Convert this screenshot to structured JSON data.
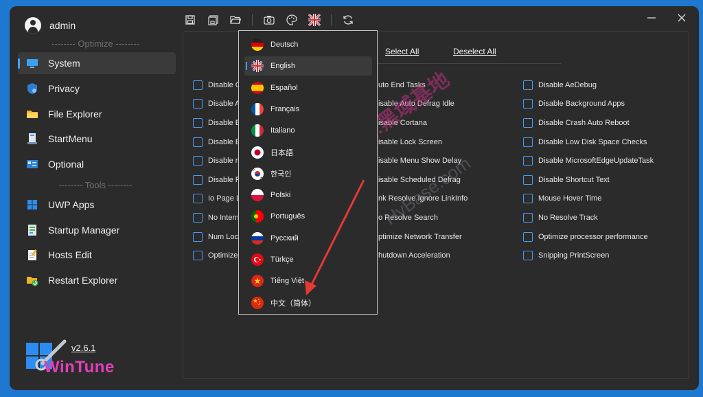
{
  "user": {
    "name": "admin"
  },
  "sidebar": {
    "optimize_title": "-------- Optimize --------",
    "tools_title": "-------- Tools --------",
    "items": [
      {
        "label": "System",
        "icon": "monitor-icon"
      },
      {
        "label": "Privacy",
        "icon": "shield-icon"
      },
      {
        "label": "File Explorer",
        "icon": "folder-icon"
      },
      {
        "label": "StartMenu",
        "icon": "start-menu-icon"
      },
      {
        "label": "Optional",
        "icon": "optional-icon"
      }
    ],
    "tools": [
      {
        "label": "UWP Apps",
        "icon": "windows-icon"
      },
      {
        "label": "Startup Manager",
        "icon": "startup-icon"
      },
      {
        "label": "Hosts Edit",
        "icon": "notepad-icon"
      },
      {
        "label": "Restart Explorer",
        "icon": "restart-icon"
      }
    ]
  },
  "app": {
    "version": "v2.6.1",
    "logo_text": "WinTune"
  },
  "toolbar": {
    "icons": [
      "save-icon",
      "save-all-icon",
      "open-folder-icon",
      "screenshot-icon",
      "theme-icon",
      "language-flag-icon",
      "refresh-icon"
    ]
  },
  "content": {
    "select_all": "Select All",
    "deselect_all": "Deselect All",
    "col1": [
      "Disable G",
      "Disable A",
      "Disable Bo",
      "Disable Er",
      "Disable m",
      "Disable Pr",
      "Io Page Lo",
      "No Intern",
      "Num Lock",
      "Optimize"
    ],
    "col2": [
      "uto End Tasks",
      "isable Auto Defrag Idle",
      "isable Cortana",
      "isable Lock Screen",
      "isable Menu Show Delay",
      "isable Scheduled Defrag",
      "nk Resolve Ignore LinkInfo",
      "o Resolve Search",
      "ptimize Network Transfer",
      "hutdown Acceleration"
    ],
    "col3": [
      "Disable AeDebug",
      "Disable Background Apps",
      "Disable Crash Auto Reboot",
      "Disable Low Disk Space Checks",
      "Disable MicrosoftEdgeUpdateTask",
      "Disable Shortcut Text",
      "Mouse Hover Time",
      "No Resolve Track",
      "Optimize processor performance",
      "Snipping PrintScreen"
    ]
  },
  "languages": {
    "selected": "English",
    "items": [
      {
        "label": "Deutsch",
        "icon": "flag-germany-icon"
      },
      {
        "label": "English",
        "icon": "flag-uk-icon"
      },
      {
        "label": "Español",
        "icon": "flag-spain-icon"
      },
      {
        "label": "Français",
        "icon": "flag-france-icon"
      },
      {
        "label": "Italiano",
        "icon": "flag-italy-icon"
      },
      {
        "label": "日本語",
        "icon": "flag-japan-icon"
      },
      {
        "label": "한국인",
        "icon": "flag-korea-icon"
      },
      {
        "label": "Polski",
        "icon": "flag-poland-icon"
      },
      {
        "label": "Português",
        "icon": "flag-portugal-icon"
      },
      {
        "label": "Русский",
        "icon": "flag-russia-icon"
      },
      {
        "label": "Türkçe",
        "icon": "flag-turkey-icon"
      },
      {
        "label": "Tiếng Việt",
        "icon": "flag-vietnam-icon"
      },
      {
        "label": "中文（简体）",
        "icon": "flag-china-icon"
      }
    ]
  },
  "watermark": {
    "text1": "记得收藏:黑域基地",
    "text2": "HyBase.com"
  },
  "colors": {
    "accent": "#3fa3ff",
    "window_bg": "#2b2b2b",
    "desktop_bg": "#1e78d0",
    "arrow": "#e53935"
  }
}
